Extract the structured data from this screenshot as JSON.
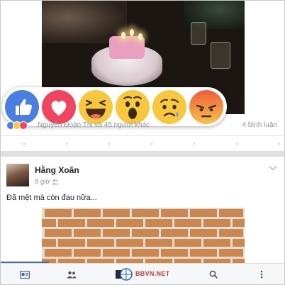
{
  "post1": {
    "reactions": [
      {
        "name": "like",
        "color": "#4a7fe0"
      },
      {
        "name": "love",
        "color": "#f0455f"
      },
      {
        "name": "haha",
        "color": "#f7c83d"
      },
      {
        "name": "wow",
        "color": "#f7c83d"
      },
      {
        "name": "sad",
        "color": "#f7c83d"
      },
      {
        "name": "angry",
        "color": "#ef5d3b"
      }
    ],
    "summary_text": "Nguyễn Đoàn Thi và 45 người khác",
    "comment_count": "4 bình luận"
  },
  "post2": {
    "author": "Hằng Xoăn",
    "time": "8 giờ ·",
    "status": "Đã mệt mà còn đau nữa...",
    "privacy_icon": "friends-icon"
  },
  "bottom_nav": {
    "items": [
      "news-feed-icon",
      "friends-icon",
      "notifications-icon",
      "search-icon",
      "more-icon"
    ],
    "watermark": "BBVN.NET"
  },
  "colors": {
    "accent": "#4267b2",
    "separator": "#dddfe2",
    "muted_text": "#90949c"
  }
}
